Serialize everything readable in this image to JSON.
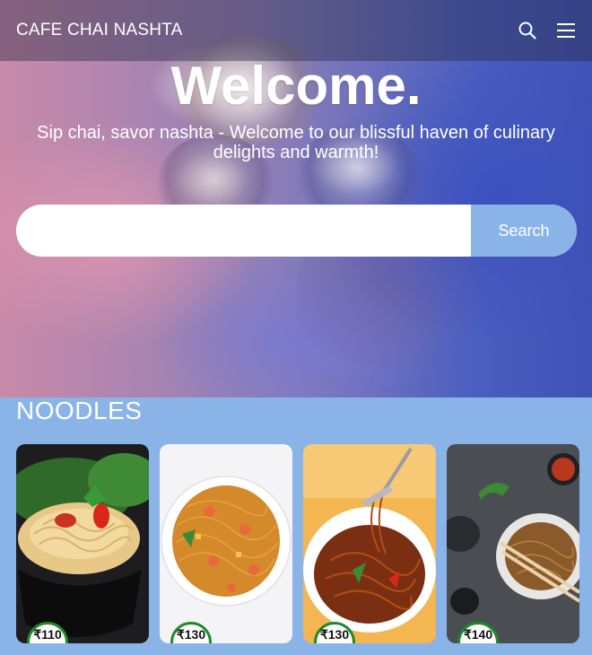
{
  "navbar": {
    "brand": "CAFE CHAI NASHTA",
    "icons": [
      "search-icon",
      "menu-icon"
    ]
  },
  "hero": {
    "heading": "Welcome.",
    "tagline": "Sip chai, savor nashta - Welcome to our blissful haven of culinary delights and warmth!",
    "search": {
      "placeholder": "",
      "value": "",
      "button_label": "Search"
    }
  },
  "section": {
    "title": "NOODLES",
    "items": [
      {
        "price": "₹110"
      },
      {
        "price": "₹130"
      },
      {
        "price": "₹130"
      },
      {
        "price": "₹140"
      }
    ]
  },
  "colors": {
    "accent": "#8ab4e8",
    "price_border": "#1e8a2a",
    "navbar": "#282c46"
  }
}
